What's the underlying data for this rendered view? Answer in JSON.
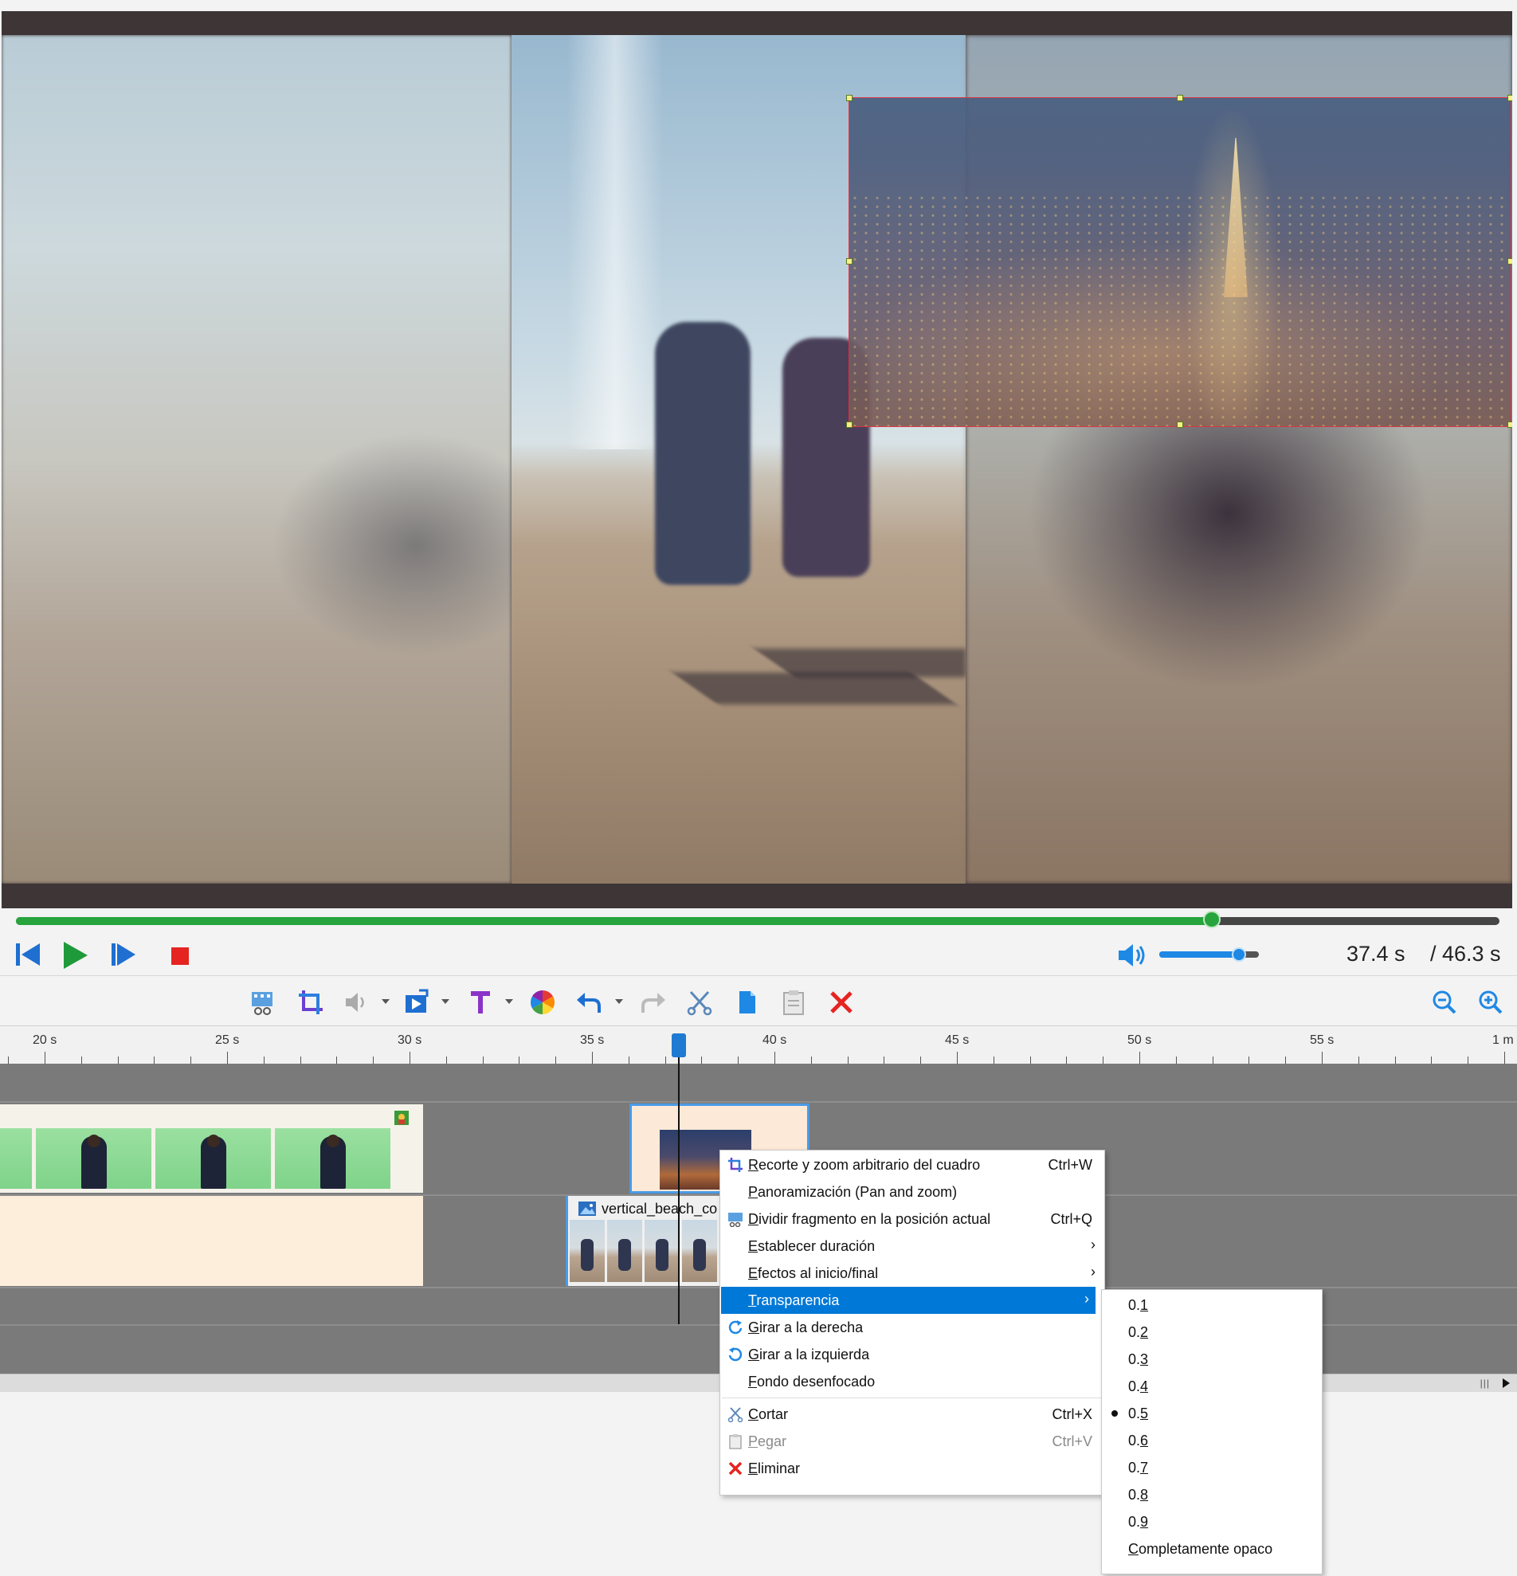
{
  "player": {
    "current_time": "37.4 s",
    "total_time": "/ 46.3 s",
    "progress_fraction": 0.806,
    "volume_fraction": 0.8
  },
  "toolbar": {
    "tools": [
      {
        "name": "split-clip-icon"
      },
      {
        "name": "crop-icon"
      },
      {
        "name": "volume-icon"
      },
      {
        "name": "transitions-icon"
      },
      {
        "name": "text-icon"
      },
      {
        "name": "color-icon"
      },
      {
        "name": "undo-icon"
      },
      {
        "name": "redo-icon"
      },
      {
        "name": "cut-icon"
      },
      {
        "name": "copy-icon"
      },
      {
        "name": "paste-icon"
      },
      {
        "name": "delete-icon"
      },
      {
        "name": "zoom-out-icon"
      },
      {
        "name": "zoom-in-icon"
      }
    ]
  },
  "timeline": {
    "ticks": [
      "20 s",
      "25 s",
      "30 s",
      "35 s",
      "40 s",
      "45 s",
      "50 s",
      "55 s",
      "1 m"
    ],
    "clip_label": "vertical_beach_co"
  },
  "context_menu": {
    "items": [
      {
        "label": "Recorte y zoom arbitrario del cuadro",
        "shortcut": "Ctrl+W",
        "icon": "crop-icon"
      },
      {
        "label": "Panoramización (Pan and zoom)",
        "shortcut": "",
        "icon": ""
      },
      {
        "label": "Dividir fragmento en la posición actual",
        "shortcut": "Ctrl+Q",
        "icon": "split-icon"
      },
      {
        "label": "Establecer duración",
        "shortcut": "",
        "icon": "",
        "submenu": true
      },
      {
        "label": "Efectos al inicio/final",
        "shortcut": "",
        "icon": "",
        "submenu": true
      },
      {
        "label": "Transparencia",
        "shortcut": "",
        "icon": "",
        "submenu": true,
        "selected": true
      },
      {
        "label": "Girar a la derecha",
        "shortcut": "",
        "icon": "rotate-right-icon"
      },
      {
        "label": "Girar a la izquierda",
        "shortcut": "",
        "icon": "rotate-left-icon"
      },
      {
        "label": "Fondo desenfocado",
        "shortcut": "",
        "icon": ""
      },
      {
        "label": "Cortar",
        "shortcut": "Ctrl+X",
        "icon": "cut-icon"
      },
      {
        "label": "Pegar",
        "shortcut": "Ctrl+V",
        "icon": "paste-icon",
        "disabled": true
      },
      {
        "label": "Eliminar",
        "shortcut": "",
        "icon": "delete-icon"
      }
    ]
  },
  "transparency_menu": {
    "items": [
      "0.1",
      "0.2",
      "0.3",
      "0.4",
      "0.5",
      "0.6",
      "0.7",
      "0.8",
      "0.9",
      "Completamente opaco"
    ],
    "checked": "0.5"
  },
  "colors": {
    "accent": "#0078d7",
    "seek_fill": "#27a43c",
    "selection_border": "#e03040",
    "clip_highlight": "#4a9be8"
  }
}
